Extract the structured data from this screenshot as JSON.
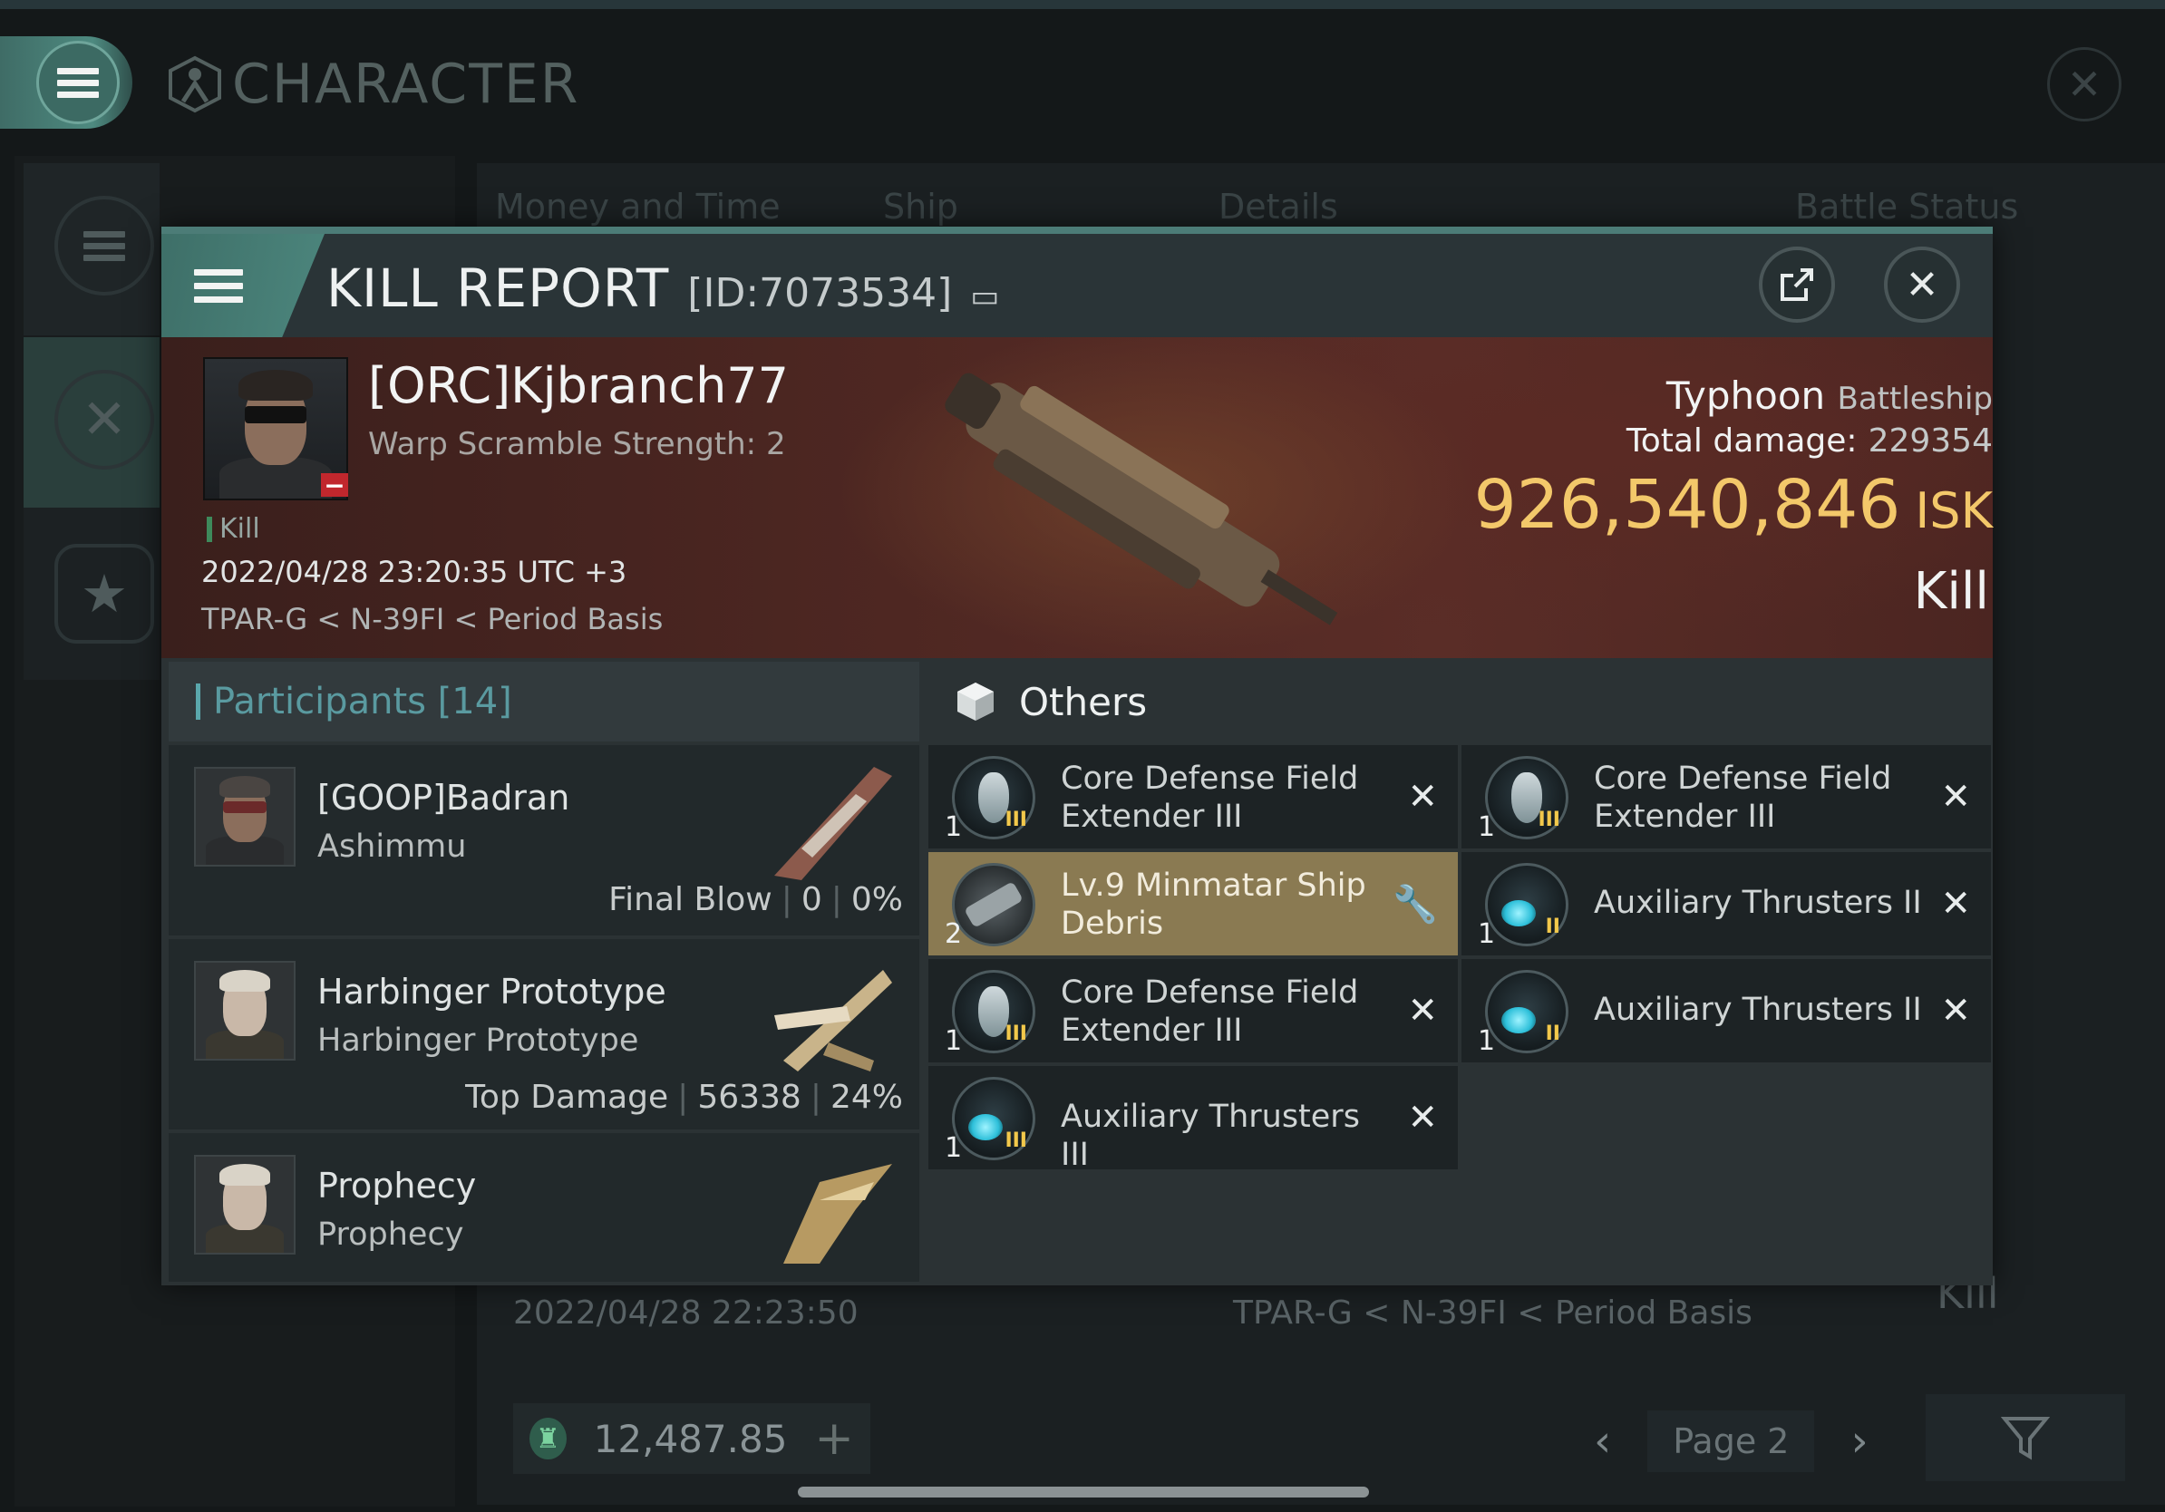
{
  "background": {
    "window_title": "CHARACTER",
    "tabs": [
      "Money and Time",
      "Ship",
      "Details",
      "Battle Status"
    ],
    "row": {
      "date": "2022/04/28  22:23:50",
      "location": "TPAR-G < N-39FI < Period Basis",
      "result": "Kill"
    },
    "wallet": {
      "amount": "12,487.85",
      "add_icon": "plus-icon",
      "currency_icon": "plex-icon"
    },
    "pager": {
      "page_label": "Page 2",
      "prev_icon": "chevron-left-icon",
      "next_icon": "chevron-right-icon"
    },
    "filter_icon": "filter-icon"
  },
  "modal": {
    "title": "KILL REPORT",
    "id_label": "[ID:7073534]",
    "share_icon": "share-icon",
    "close_icon": "close-icon"
  },
  "victim": {
    "pilot": "[ORC]Kjbranch77",
    "warp_scramble": "Warp Scramble Strength: 2",
    "tag": "Kill",
    "timestamp": "2022/04/28 23:20:35 UTC +3",
    "location": "TPAR-G < N-39FI < Period Basis",
    "ship_name": "Typhoon",
    "ship_class": "Battleship",
    "damage_label": "Total damage:",
    "damage_value": "229354",
    "isk_value": "926,540,846",
    "isk_unit": "ISK",
    "result": "Kill"
  },
  "participants": {
    "header": "Participants [14]",
    "rows": [
      {
        "name": "[GOOP]Badran",
        "ship": "Ashimmu",
        "stat_label": "Final Blow",
        "damage": "0",
        "percent": "0%"
      },
      {
        "name": "Harbinger Prototype",
        "ship": "Harbinger Prototype",
        "stat_label": "Top Damage",
        "damage": "56338",
        "percent": "24%"
      },
      {
        "name": "Prophecy",
        "ship": "Prophecy"
      }
    ]
  },
  "others": {
    "header": "Others",
    "items": [
      {
        "name": "Core Defense Field Extender III",
        "line1": "Core Defense Field",
        "line2": "Extender III",
        "qty": "1",
        "meta": "III",
        "status": "destroyed"
      },
      {
        "name": "Core Defense Field Extender III",
        "line1": "Core Defense Field",
        "line2": "Extender III",
        "qty": "1",
        "meta": "III",
        "status": "destroyed"
      },
      {
        "name": "Lv.9 Minmatar Ship Debris",
        "line1": "Lv.9 Minmatar Ship",
        "line2": "Debris",
        "qty": "2",
        "status": "dropped"
      },
      {
        "name": "Auxiliary Thrusters II",
        "qty": "1",
        "meta": "II",
        "status": "destroyed"
      },
      {
        "name": "Core Defense Field Extender III",
        "line1": "Core Defense Field",
        "line2": "Extender III",
        "qty": "1",
        "meta": "III",
        "status": "destroyed"
      },
      {
        "name": "Auxiliary Thrusters II",
        "qty": "1",
        "meta": "II",
        "status": "destroyed"
      },
      {
        "name": "Auxiliary Thrusters III",
        "qty": "1",
        "meta": "III",
        "status": "destroyed"
      }
    ]
  },
  "colors": {
    "accent": "#4c867d",
    "isk": "#f3c86a",
    "dropped": "#8a7a52",
    "minus_badge": "#c1272d"
  }
}
